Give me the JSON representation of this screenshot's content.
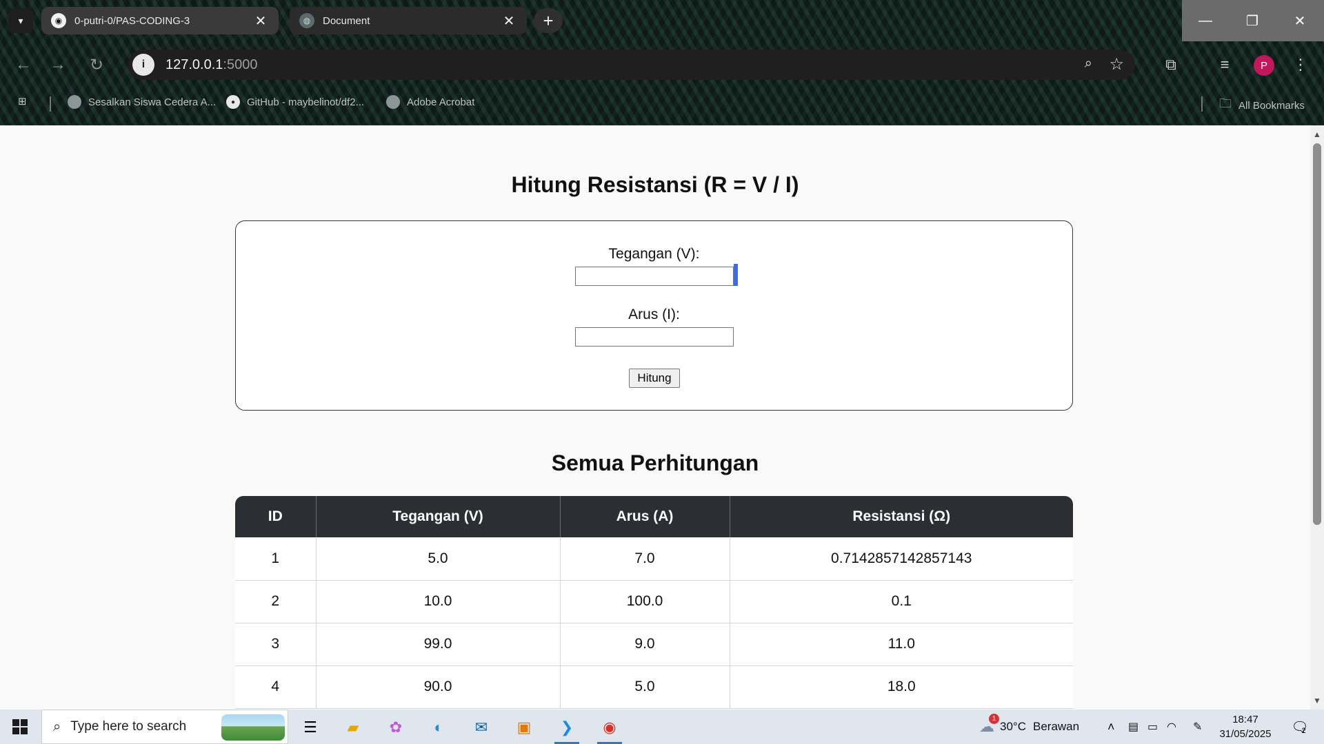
{
  "browser": {
    "tabs": [
      {
        "title": "0-putri-0/PAS-CODING-3",
        "icon": "github-icon",
        "active": true
      },
      {
        "title": "Document",
        "icon": "globe-icon",
        "active": false
      }
    ],
    "url_host": "127.0.0.1",
    "url_port": ":5000",
    "bookmarks": [
      {
        "label": "Sesalkan Siswa Cedera A...",
        "icon": "globe-icon"
      },
      {
        "label": "GitHub - maybelinot/df2...",
        "icon": "github-icon"
      },
      {
        "label": "Adobe Acrobat",
        "icon": "globe-icon"
      }
    ],
    "all_bookmarks": "All Bookmarks",
    "profile_initial": "P"
  },
  "page": {
    "title": "Hitung Resistansi (R = V / I)",
    "form": {
      "voltage_label": "Tegangan (V):",
      "voltage_value": "",
      "current_label": "Arus (I):",
      "current_value": "",
      "submit_label": "Hitung"
    },
    "results_title": "Semua Perhitungan",
    "table": {
      "headers": [
        "ID",
        "Tegangan (V)",
        "Arus (A)",
        "Resistansi (Ω)"
      ],
      "rows": [
        [
          "1",
          "5.0",
          "7.0",
          "0.7142857142857143"
        ],
        [
          "2",
          "10.0",
          "100.0",
          "0.1"
        ],
        [
          "3",
          "99.0",
          "9.0",
          "11.0"
        ],
        [
          "4",
          "90.0",
          "5.0",
          "18.0"
        ]
      ]
    }
  },
  "taskbar": {
    "search_placeholder": "Type here to search",
    "weather_temp": "30°C",
    "weather_text": "Berawan",
    "weather_badge": "1",
    "time": "18:47",
    "date": "31/05/2025",
    "notification_count": "2"
  },
  "colors": {
    "table_header_bg": "#2b2f33",
    "profile_avatar": "#c2185b",
    "text_cursor": "#3b6fe0"
  }
}
